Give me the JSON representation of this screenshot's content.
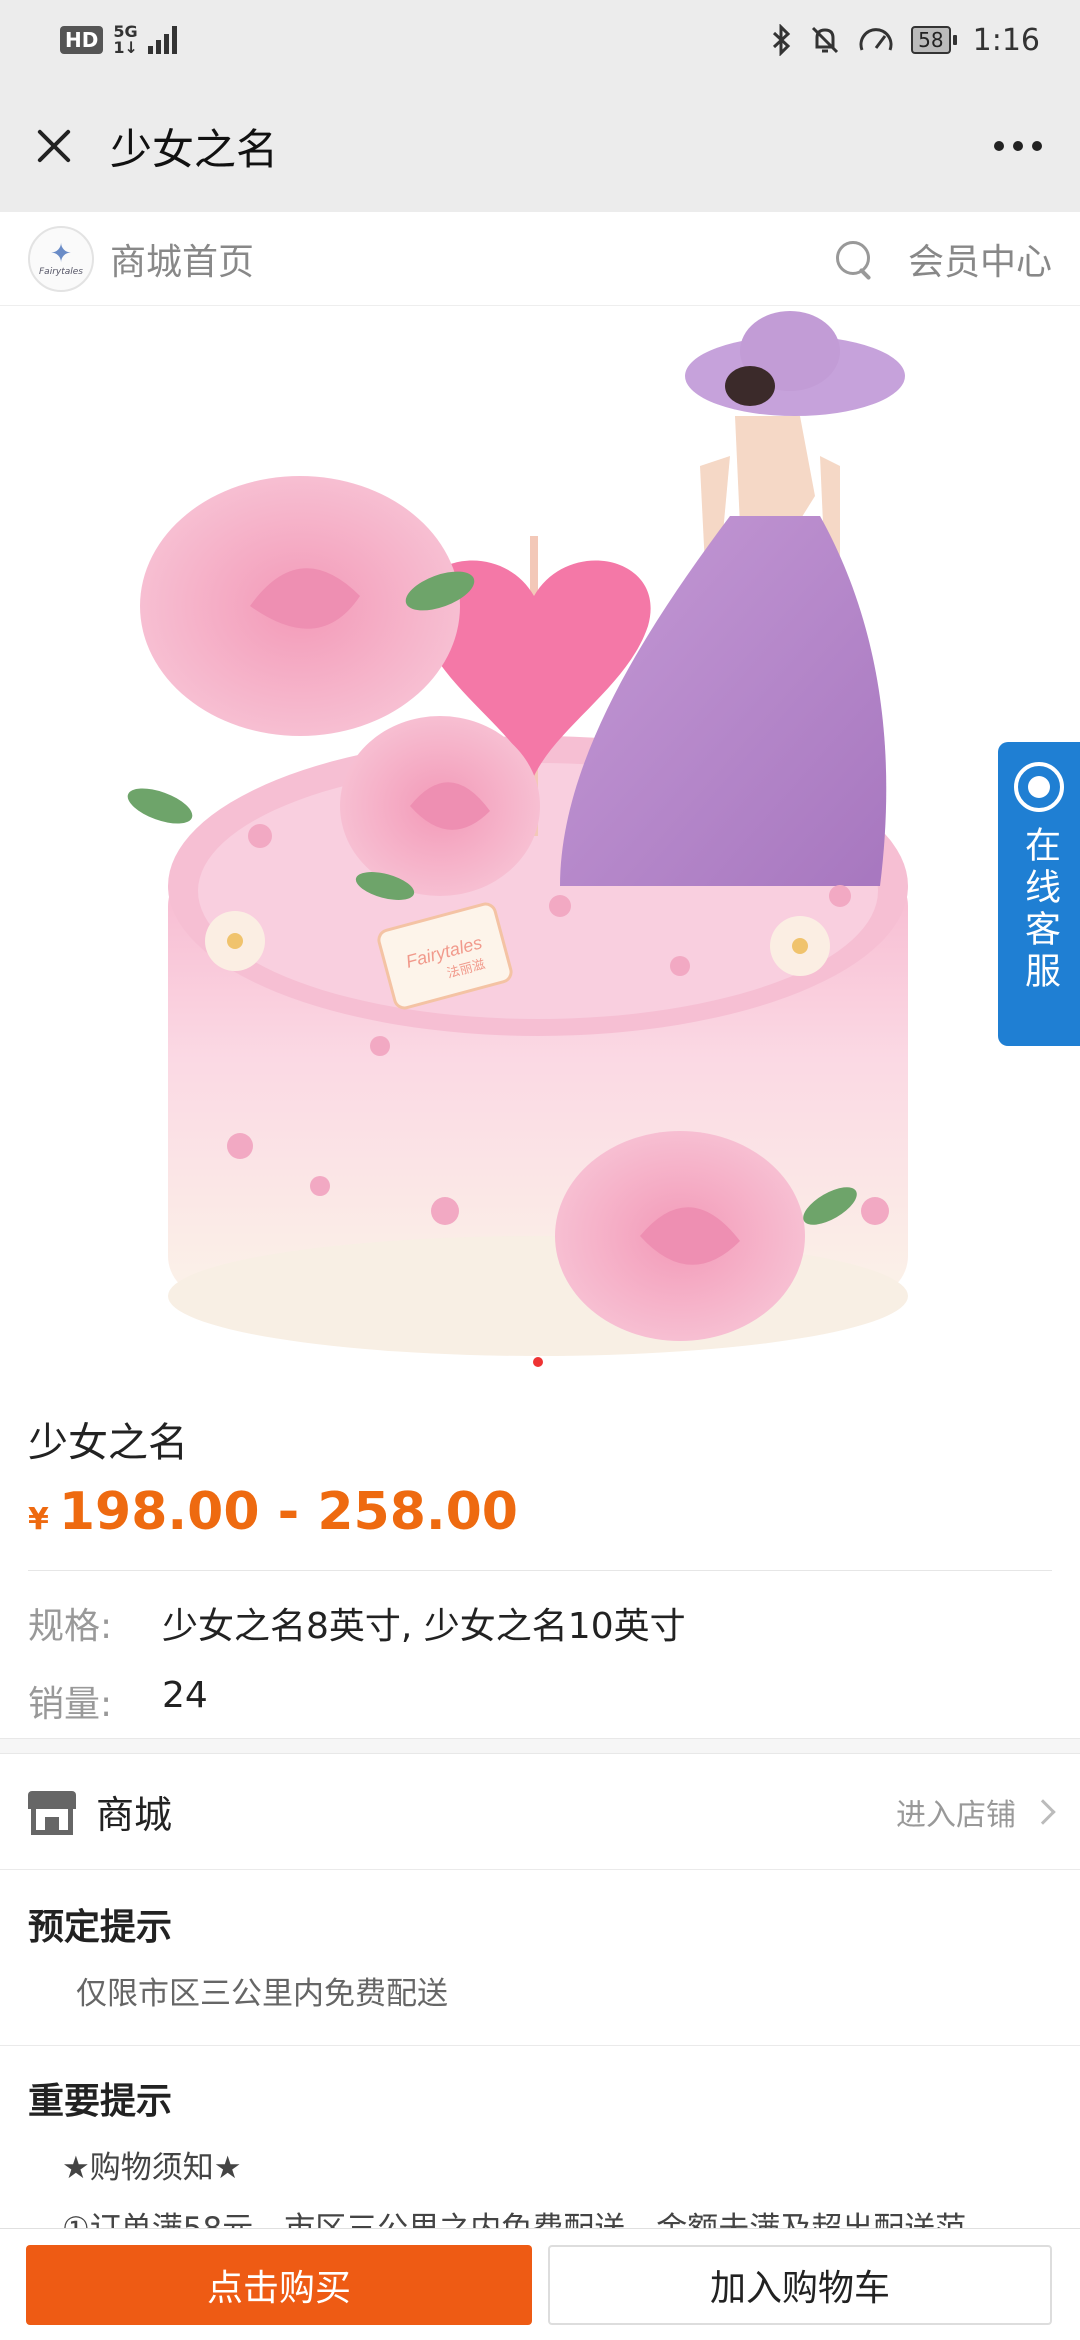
{
  "status_bar": {
    "hd": "HD",
    "network": "5G",
    "network_sub": "1↓",
    "battery": "58",
    "time": "1:16"
  },
  "header": {
    "title": "少女之名"
  },
  "shop_header": {
    "home_label": "商城首页",
    "member_label": "会员中心",
    "logo_text": "Fairytales"
  },
  "product": {
    "name": "少女之名",
    "currency": "¥",
    "price_range": "198.00 - 258.00",
    "spec_label": "规格:",
    "spec_value": "少女之名8英寸, 少女之名10英寸",
    "sales_label": "销量:",
    "sales_value": "24",
    "image_logo": "Fairytales",
    "image_logo_sub": "法丽滋"
  },
  "service": {
    "label": "在线客服"
  },
  "store": {
    "name": "商城",
    "enter_label": "进入店铺"
  },
  "notices": {
    "booking_title": "预定提示",
    "booking_text": "仅限市区三公里内免费配送",
    "important_title": "重要提示",
    "important_line1": "★购物须知★",
    "important_line2": "①订单满58元，市区三公里之内免费配送，金额未满及超出配送范"
  },
  "bottom_bar": {
    "buy_label": "点击购买",
    "cart_label": "加入购物车"
  },
  "colors": {
    "accent": "#ee5b14",
    "price": "#ee6a10",
    "service": "#1f7fd3"
  }
}
